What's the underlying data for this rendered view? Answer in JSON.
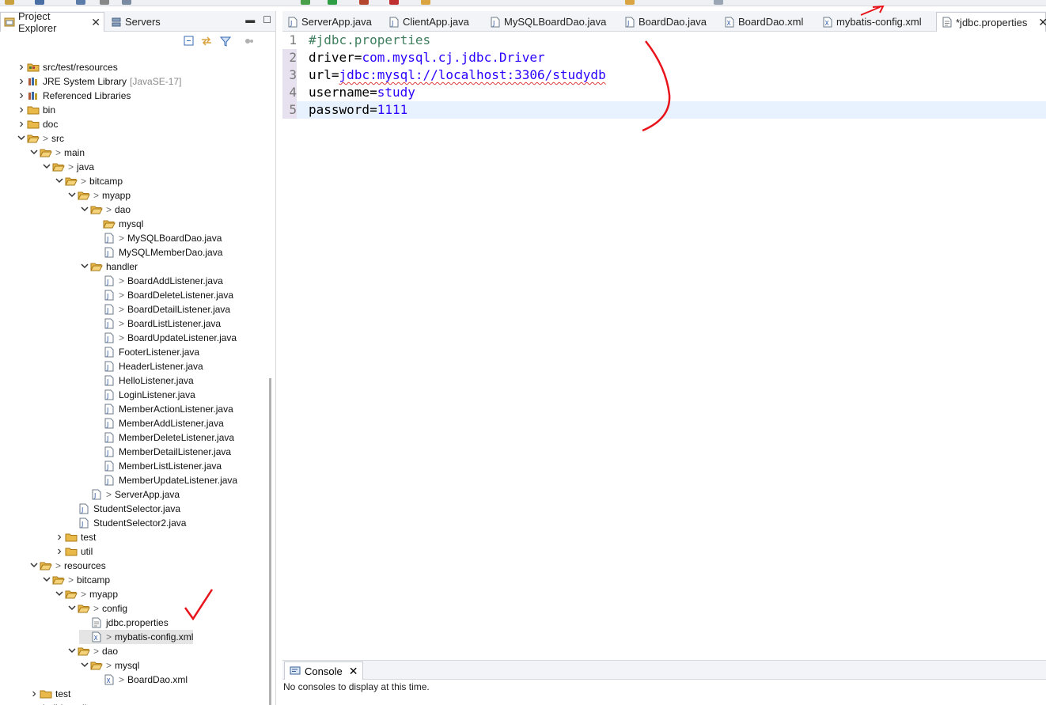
{
  "left_pane": {
    "tabs": [
      {
        "label": "Project Explorer",
        "icon": "project-explorer-icon",
        "active": true,
        "closable": true
      },
      {
        "label": "Servers",
        "icon": "servers-icon",
        "active": false,
        "closable": false
      }
    ],
    "tree": [
      {
        "indent": 0,
        "chevron": ">",
        "icon": "source-folder-icon",
        "prefix": "",
        "label": "src/test/resources",
        "suffix": ""
      },
      {
        "indent": 0,
        "chevron": ">",
        "icon": "library-icon",
        "prefix": "",
        "label": "JRE System Library",
        "suffix": "[JavaSE-17]"
      },
      {
        "indent": 0,
        "chevron": ">",
        "icon": "library-icon",
        "prefix": "",
        "label": "Referenced Libraries",
        "suffix": ""
      },
      {
        "indent": 0,
        "chevron": ">",
        "icon": "folder-icon",
        "prefix": "",
        "label": "bin",
        "suffix": ""
      },
      {
        "indent": 0,
        "chevron": ">",
        "icon": "folder-icon",
        "prefix": "",
        "label": "doc",
        "suffix": ""
      },
      {
        "indent": 0,
        "chevron": "v",
        "icon": "folder-open-icon",
        "prefix": ">",
        "label": "src",
        "suffix": ""
      },
      {
        "indent": 1,
        "chevron": "v",
        "icon": "folder-open-icon",
        "prefix": ">",
        "label": "main",
        "suffix": ""
      },
      {
        "indent": 2,
        "chevron": "v",
        "icon": "folder-open-icon",
        "prefix": ">",
        "label": "java",
        "suffix": ""
      },
      {
        "indent": 3,
        "chevron": "v",
        "icon": "folder-open-icon",
        "prefix": ">",
        "label": "bitcamp",
        "suffix": ""
      },
      {
        "indent": 4,
        "chevron": "v",
        "icon": "folder-open-icon",
        "prefix": ">",
        "label": "myapp",
        "suffix": ""
      },
      {
        "indent": 5,
        "chevron": "v",
        "icon": "folder-open-icon",
        "prefix": ">",
        "label": "dao",
        "suffix": ""
      },
      {
        "indent": 6,
        "chevron": "",
        "icon": "folder-open-icon",
        "prefix": "",
        "label": "mysql",
        "suffix": ""
      },
      {
        "indent": 6,
        "chevron": "",
        "icon": "java-file-icon",
        "prefix": ">",
        "label": "MySQLBoardDao.java",
        "suffix": ""
      },
      {
        "indent": 6,
        "chevron": "",
        "icon": "java-file-icon",
        "prefix": "",
        "label": "MySQLMemberDao.java",
        "suffix": ""
      },
      {
        "indent": 5,
        "chevron": "v",
        "icon": "folder-open-icon",
        "prefix": "",
        "label": "handler",
        "suffix": ""
      },
      {
        "indent": 6,
        "chevron": "",
        "icon": "java-file-icon",
        "prefix": ">",
        "label": "BoardAddListener.java",
        "suffix": ""
      },
      {
        "indent": 6,
        "chevron": "",
        "icon": "java-file-icon",
        "prefix": ">",
        "label": "BoardDeleteListener.java",
        "suffix": ""
      },
      {
        "indent": 6,
        "chevron": "",
        "icon": "java-file-icon",
        "prefix": ">",
        "label": "BoardDetailListener.java",
        "suffix": ""
      },
      {
        "indent": 6,
        "chevron": "",
        "icon": "java-file-icon",
        "prefix": ">",
        "label": "BoardListListener.java",
        "suffix": ""
      },
      {
        "indent": 6,
        "chevron": "",
        "icon": "java-file-icon",
        "prefix": ">",
        "label": "BoardUpdateListener.java",
        "suffix": ""
      },
      {
        "indent": 6,
        "chevron": "",
        "icon": "java-file-icon",
        "prefix": "",
        "label": "FooterListener.java",
        "suffix": ""
      },
      {
        "indent": 6,
        "chevron": "",
        "icon": "java-file-icon",
        "prefix": "",
        "label": "HeaderListener.java",
        "suffix": ""
      },
      {
        "indent": 6,
        "chevron": "",
        "icon": "java-file-icon",
        "prefix": "",
        "label": "HelloListener.java",
        "suffix": ""
      },
      {
        "indent": 6,
        "chevron": "",
        "icon": "java-file-icon",
        "prefix": "",
        "label": "LoginListener.java",
        "suffix": ""
      },
      {
        "indent": 6,
        "chevron": "",
        "icon": "java-file-icon",
        "prefix": "",
        "label": "MemberActionListener.java",
        "suffix": ""
      },
      {
        "indent": 6,
        "chevron": "",
        "icon": "java-file-icon",
        "prefix": "",
        "label": "MemberAddListener.java",
        "suffix": ""
      },
      {
        "indent": 6,
        "chevron": "",
        "icon": "java-file-icon",
        "prefix": "",
        "label": "MemberDeleteListener.java",
        "suffix": ""
      },
      {
        "indent": 6,
        "chevron": "",
        "icon": "java-file-icon",
        "prefix": "",
        "label": "MemberDetailListener.java",
        "suffix": ""
      },
      {
        "indent": 6,
        "chevron": "",
        "icon": "java-file-icon",
        "prefix": "",
        "label": "MemberListListener.java",
        "suffix": ""
      },
      {
        "indent": 6,
        "chevron": "",
        "icon": "java-file-icon",
        "prefix": "",
        "label": "MemberUpdateListener.java",
        "suffix": ""
      },
      {
        "indent": 5,
        "chevron": "",
        "icon": "java-file-icon",
        "prefix": ">",
        "label": "ServerApp.java",
        "suffix": ""
      },
      {
        "indent": 4,
        "chevron": "",
        "icon": "java-file-icon",
        "prefix": "",
        "label": "StudentSelector.java",
        "suffix": ""
      },
      {
        "indent": 4,
        "chevron": "",
        "icon": "java-file-icon",
        "prefix": "",
        "label": "StudentSelector2.java",
        "suffix": ""
      },
      {
        "indent": 3,
        "chevron": ">",
        "icon": "folder-icon",
        "prefix": "",
        "label": "test",
        "suffix": ""
      },
      {
        "indent": 3,
        "chevron": ">",
        "icon": "folder-icon",
        "prefix": "",
        "label": "util",
        "suffix": ""
      },
      {
        "indent": 1,
        "chevron": "v",
        "icon": "folder-open-icon",
        "prefix": ">",
        "label": "resources",
        "suffix": ""
      },
      {
        "indent": 2,
        "chevron": "v",
        "icon": "folder-open-icon",
        "prefix": ">",
        "label": "bitcamp",
        "suffix": ""
      },
      {
        "indent": 3,
        "chevron": "v",
        "icon": "folder-open-icon",
        "prefix": ">",
        "label": "myapp",
        "suffix": ""
      },
      {
        "indent": 4,
        "chevron": "v",
        "icon": "folder-open-icon",
        "prefix": ">",
        "label": "config",
        "suffix": ""
      },
      {
        "indent": 5,
        "chevron": "",
        "icon": "properties-file-icon",
        "prefix": "",
        "label": "jdbc.properties",
        "suffix": ""
      },
      {
        "indent": 5,
        "chevron": "",
        "icon": "xml-file-icon",
        "prefix": ">",
        "label": "mybatis-config.xml",
        "suffix": "",
        "selected": true
      },
      {
        "indent": 4,
        "chevron": "v",
        "icon": "folder-open-icon",
        "prefix": ">",
        "label": "dao",
        "suffix": ""
      },
      {
        "indent": 5,
        "chevron": "v",
        "icon": "folder-open-icon",
        "prefix": ">",
        "label": "mysql",
        "suffix": ""
      },
      {
        "indent": 6,
        "chevron": "",
        "icon": "xml-file-icon",
        "prefix": ">",
        "label": "BoardDao.xml",
        "suffix": ""
      },
      {
        "indent": 1,
        "chevron": ">",
        "icon": "folder-icon",
        "prefix": "",
        "label": "test",
        "suffix": ""
      },
      {
        "indent": 0,
        "chevron": "",
        "icon": "gradle-icon",
        "prefix": "",
        "label": "build.gradle",
        "suffix": ""
      }
    ]
  },
  "editor": {
    "tabs": [
      {
        "label": "ServerApp.java",
        "icon": "java-file-icon",
        "active": false
      },
      {
        "label": "ClientApp.java",
        "icon": "java-file-icon",
        "active": false
      },
      {
        "label": "MySQLBoardDao.java",
        "icon": "java-file-icon",
        "active": false
      },
      {
        "label": "BoardDao.java",
        "icon": "java-file-icon",
        "active": false
      },
      {
        "label": "BoardDao.xml",
        "icon": "xml-file-icon",
        "active": false
      },
      {
        "label": "mybatis-config.xml",
        "icon": "xml-file-icon",
        "active": false
      },
      {
        "label": "*jdbc.properties",
        "icon": "properties-file-icon",
        "active": true
      }
    ],
    "lines": [
      {
        "num": "1",
        "key": "#jdbc.properties",
        "eq": "",
        "value": "",
        "comment": true
      },
      {
        "num": "2",
        "key": "driver",
        "eq": "=",
        "value": "com.mysql.cj.jdbc.Driver",
        "comment": false
      },
      {
        "num": "3",
        "key": "url",
        "eq": "=",
        "value": "jdbc:mysql://localhost:3306/studydb",
        "comment": false
      },
      {
        "num": "4",
        "key": "username",
        "eq": "=",
        "value": "study",
        "comment": false
      },
      {
        "num": "5",
        "key": "password",
        "eq": "=",
        "value": "1111",
        "comment": false
      }
    ]
  },
  "console": {
    "tab_label": "Console",
    "message": "No consoles to display at this time."
  },
  "colors": {
    "value": "#2a00ff",
    "comment": "#3f7f5f",
    "annotation": "#e8141b",
    "current_line": "#e8f2fe"
  }
}
